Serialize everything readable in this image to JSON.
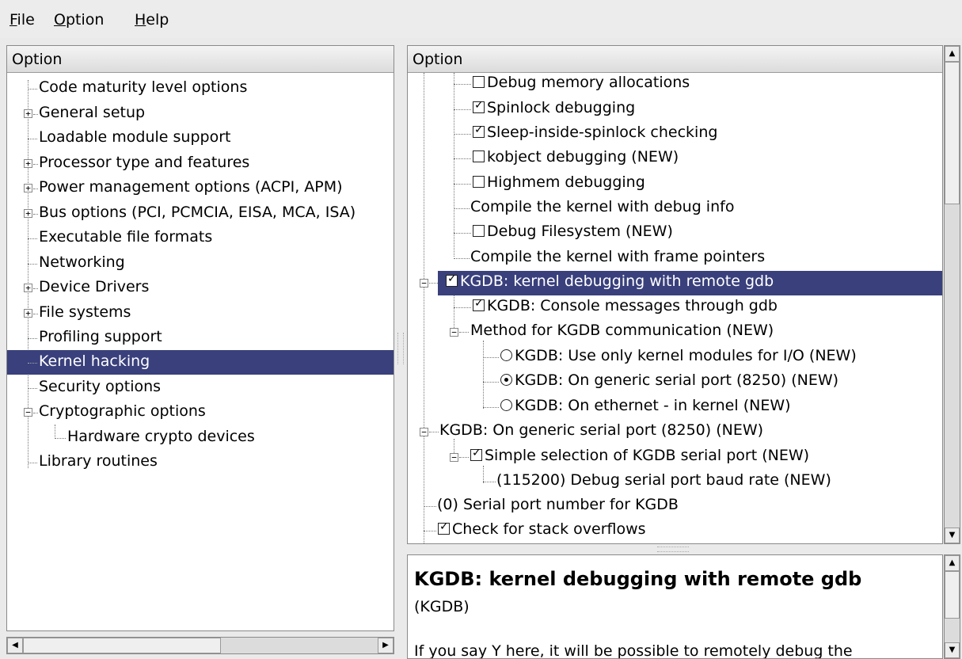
{
  "menu": [
    {
      "label": "File",
      "mnemonic": "F",
      "rest": "ile"
    },
    {
      "label": "Option",
      "mnemonic": "O",
      "rest": "ption"
    },
    {
      "label": "Help",
      "mnemonic": "H",
      "rest": "elp"
    }
  ],
  "left_tree": {
    "header": "Option",
    "items": [
      {
        "label": "Code maturity level options"
      },
      {
        "label": "General setup"
      },
      {
        "label": "Loadable module support"
      },
      {
        "label": "Processor type and features"
      },
      {
        "label": "Power management options (ACPI, APM)"
      },
      {
        "label": "Bus options (PCI, PCMCIA, EISA, MCA, ISA)"
      },
      {
        "label": "Executable file formats"
      },
      {
        "label": "Networking"
      },
      {
        "label": "Device Drivers"
      },
      {
        "label": "File systems"
      },
      {
        "label": "Profiling support"
      },
      {
        "label": "Kernel hacking"
      },
      {
        "label": "Security options"
      },
      {
        "label": "Cryptographic options"
      },
      {
        "label": "Hardware crypto devices"
      },
      {
        "label": "Library routines"
      }
    ]
  },
  "right_tree": {
    "header": "Option",
    "items": [
      {
        "label": "Debug memory allocations"
      },
      {
        "label": "Spinlock debugging"
      },
      {
        "label": "Sleep-inside-spinlock checking"
      },
      {
        "label": "kobject debugging (NEW)"
      },
      {
        "label": "Highmem debugging"
      },
      {
        "label": "Compile the kernel with debug info"
      },
      {
        "label": "Debug Filesystem (NEW)"
      },
      {
        "label": "Compile the kernel with frame pointers"
      },
      {
        "label": "KGDB: kernel debugging with remote gdb"
      },
      {
        "label": "KGDB: Console messages through gdb"
      },
      {
        "label": "Method for KGDB communication (NEW)"
      },
      {
        "label": "KGDB: Use only kernel modules for I/O (NEW)"
      },
      {
        "label": "KGDB: On generic serial port (8250) (NEW)"
      },
      {
        "label": "KGDB: On ethernet - in kernel (NEW)"
      },
      {
        "label": "KGDB: On generic serial port (8250) (NEW)"
      },
      {
        "label": "Simple selection of KGDB serial port (NEW)"
      },
      {
        "label": "(115200) Debug serial port baud rate (NEW)"
      },
      {
        "label": "(0) Serial port number for KGDB"
      },
      {
        "label": "Check for stack overflows"
      }
    ]
  },
  "help": {
    "title": "KGDB: kernel debugging with remote gdb",
    "symbol": "(KGDB)",
    "text": "If you say Y here, it will be possible to remotely debug the"
  },
  "colors": {
    "selection": "#39407c"
  }
}
